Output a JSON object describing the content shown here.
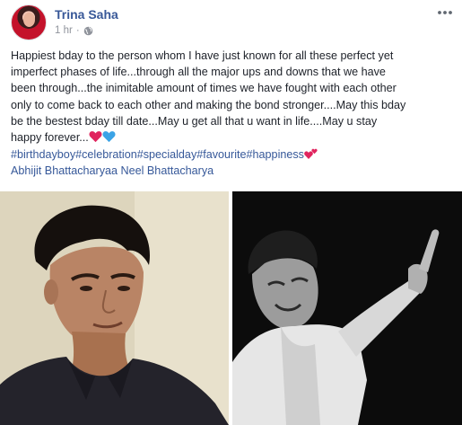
{
  "post": {
    "author": "Trina Saha",
    "time": "1 hr",
    "separator": "·",
    "privacy_icon": "globe-icon",
    "more_icon": "more-options-icon",
    "text_lines": [
      "Happiest bday to the person whom I have just known for all these perfect yet",
      "imperfect phases of life...through all the major ups and downs that we have",
      "been through...the inimitable amount of times we have fought with each other",
      "only to come back to each other and making the bond stronger....May this bday",
      "be the bestest bday till date...May u get all that u want in life....May u stay",
      "happy forever..."
    ],
    "text_emojis": [
      "red-heart-emoji",
      "blue-heart-emoji"
    ],
    "hashtags": "#birthdayboy#celebration#specialday#favourite#happiness",
    "hashtag_emoji": "two-hearts-emoji",
    "mentions": "Abhijit Bhattacharyaa Neel Bhattacharya",
    "photos": [
      {
        "name": "photo-left",
        "description_icon": "person-photo"
      },
      {
        "name": "photo-right",
        "description_icon": "person-bw-photo"
      }
    ]
  },
  "colors": {
    "link": "#365899",
    "author": "#385898",
    "meta": "#90949c",
    "text": "#1d2129",
    "heart_red": "#e0245e",
    "heart_blue": "#3ba3e6"
  }
}
